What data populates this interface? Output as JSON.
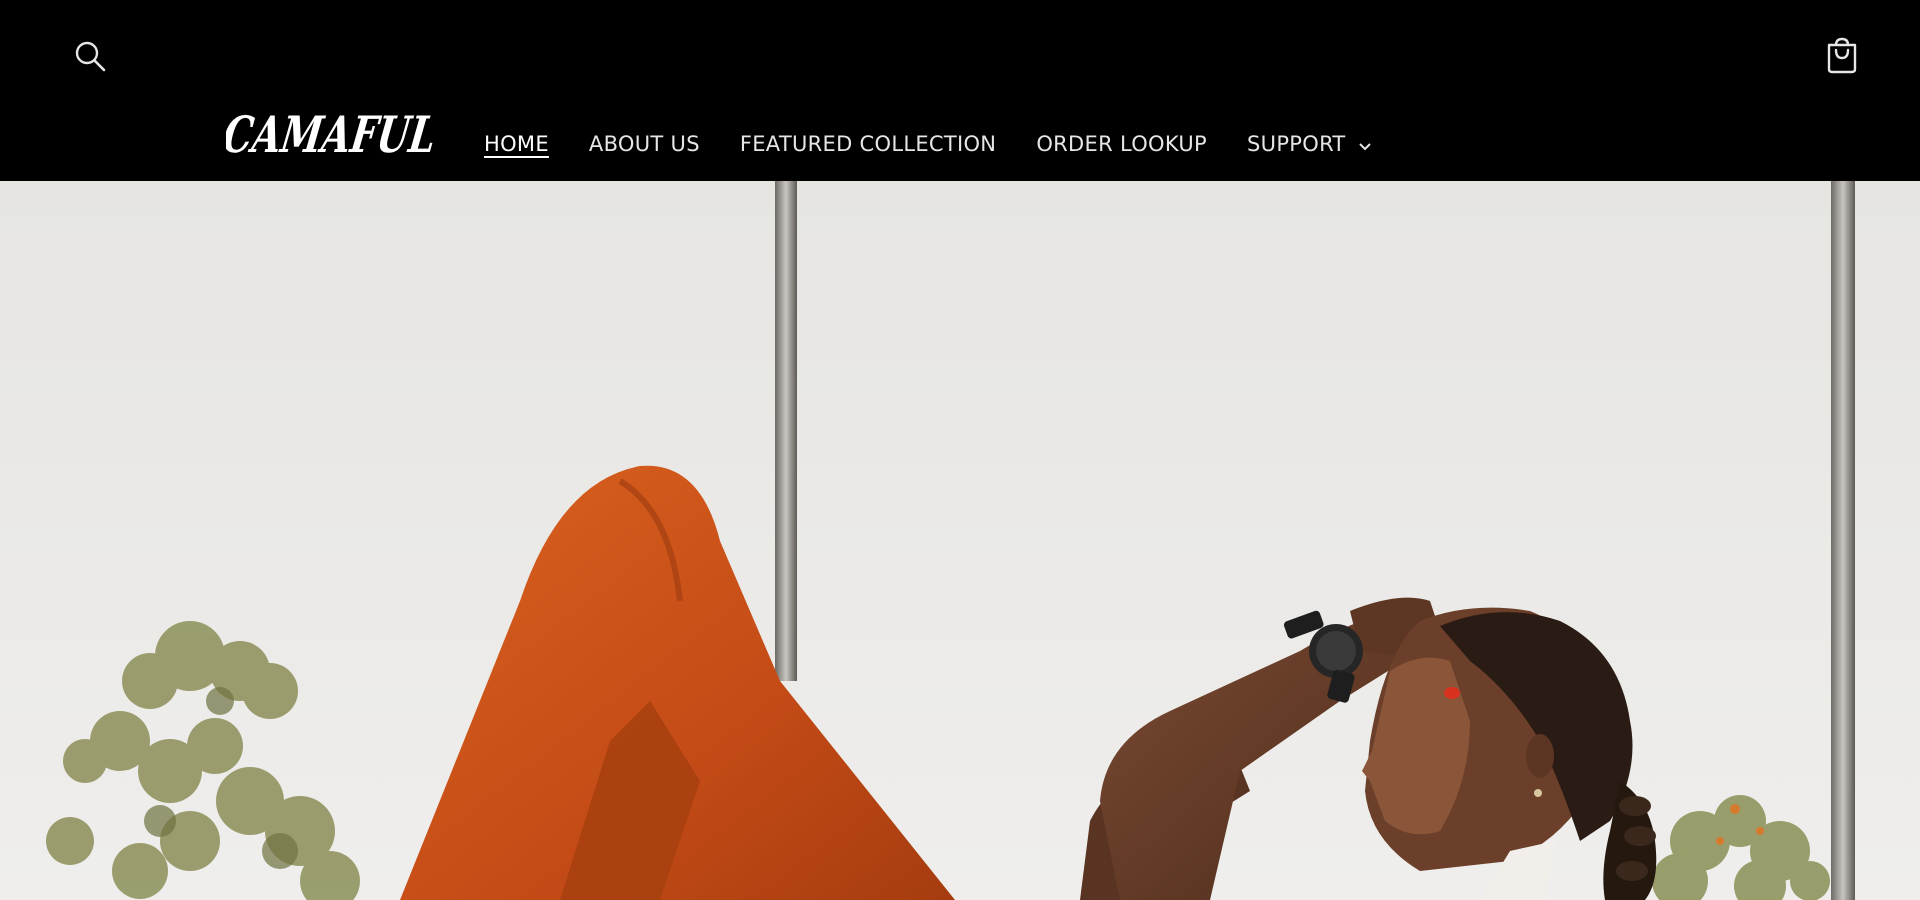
{
  "header": {
    "brand": "CAMAFUL",
    "search_icon": "search-icon",
    "cart_icon": "shopping-bag-icon"
  },
  "nav": {
    "items": [
      {
        "label": "HOME",
        "active": true
      },
      {
        "label": "ABOUT US",
        "active": false
      },
      {
        "label": "FEATURED COLLECTION",
        "active": false
      },
      {
        "label": "ORDER LOOKUP",
        "active": false
      },
      {
        "label": "SUPPORT",
        "active": false,
        "has_dropdown": true
      }
    ]
  },
  "hero": {
    "image": "woman-doing-crunch-exercise-photo"
  },
  "colors": {
    "header_bg": "#000000",
    "nav_text": "#e6e6e6",
    "leggings": "#c9521a",
    "hero_bg": "#e8e7e4"
  }
}
